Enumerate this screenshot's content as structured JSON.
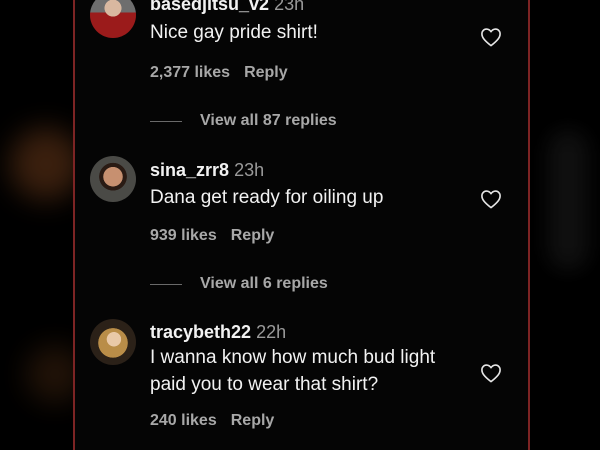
{
  "comments": [
    {
      "username": "basedjitsu_v2",
      "time": "23h",
      "text": "Nice gay pride shirt!",
      "likes": "2,377 likes",
      "reply_label": "Reply",
      "view_replies": "View all 87 replies"
    },
    {
      "username": "sina_zrr8",
      "time": "23h",
      "text": "Dana get ready for oiling up",
      "likes": "939 likes",
      "reply_label": "Reply",
      "view_replies": "View all 6 replies"
    },
    {
      "username": "tracybeth22",
      "time": "22h",
      "text": "I wanna know how much bud light paid you to wear that shirt?",
      "likes": "240 likes",
      "reply_label": "Reply"
    }
  ],
  "icons": {
    "like": "heart-outline-icon"
  },
  "colors": {
    "background": "#000000",
    "panel_border": "#7d2424",
    "primary_text": "#f2f2f2",
    "secondary_text": "#a8a8a8"
  }
}
